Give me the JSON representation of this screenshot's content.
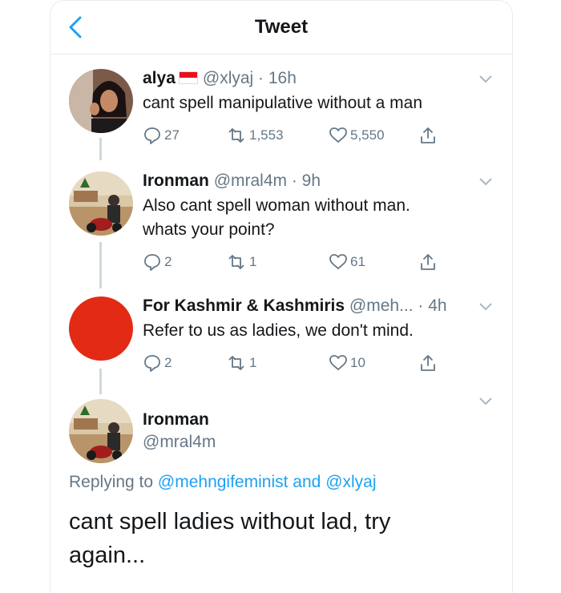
{
  "header": {
    "title": "Tweet"
  },
  "tweets": [
    {
      "name": "alya",
      "handle_time": "@xlyaj · 16h",
      "text": "cant spell manipulative without a man",
      "replies": "27",
      "retweets": "1,553",
      "likes": "5,550"
    },
    {
      "name": "Ironman",
      "handle_time": "@mral4m · 9h",
      "text_lines": [
        "Also cant spell woman without man.",
        "whats your point?"
      ],
      "replies": "2",
      "retweets": "1",
      "likes": "61"
    },
    {
      "name": "For Kashmir & Kashmiris",
      "handle_time": "@meh... · 4h",
      "text": "Refer to us as ladies, we don't mind.",
      "replies": "2",
      "retweets": "1",
      "likes": "10",
      "avatar_color": "#e32a14"
    }
  ],
  "main_tweet": {
    "name": "Ironman",
    "handle": "@mral4m",
    "replying_prefix": "Replying to",
    "replying_user1": "@mehngifeminist",
    "replying_and": "and",
    "replying_user2": "@xlyaj",
    "text": "cant spell ladies without lad, try again..."
  },
  "colors": {
    "accent": "#1da1f2",
    "muted": "#657786",
    "text": "#14171a"
  },
  "icons": [
    "back-arrow-icon",
    "reply-icon",
    "retweet-icon",
    "like-icon",
    "share-icon",
    "chevron-down-icon",
    "indonesia-flag-icon"
  ]
}
